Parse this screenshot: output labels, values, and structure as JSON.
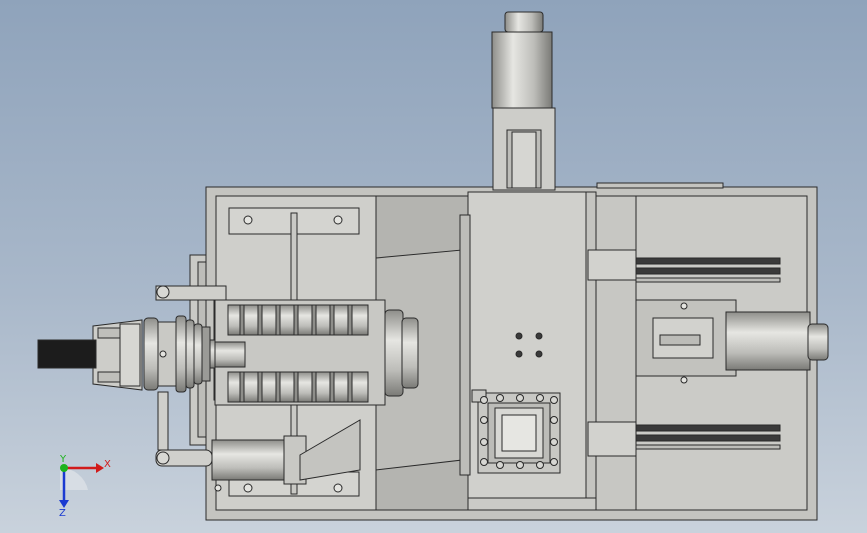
{
  "viewport": {
    "background_top": "#8fa3bb",
    "background_bottom": "#c9d2dc"
  },
  "model": {
    "body_color": "#c4c4c0",
    "panel_color": "#d2d2ce",
    "shadow_color": "#a8a8a4",
    "edge_color": "#2a2a2a",
    "dark_part_color": "#1c1c1c"
  },
  "triad": {
    "x_label": "X",
    "y_label": "Y",
    "z_label": "Z",
    "x_color": "#d11a1a",
    "y_color": "#1db31d",
    "z_color": "#1a3ad1"
  }
}
